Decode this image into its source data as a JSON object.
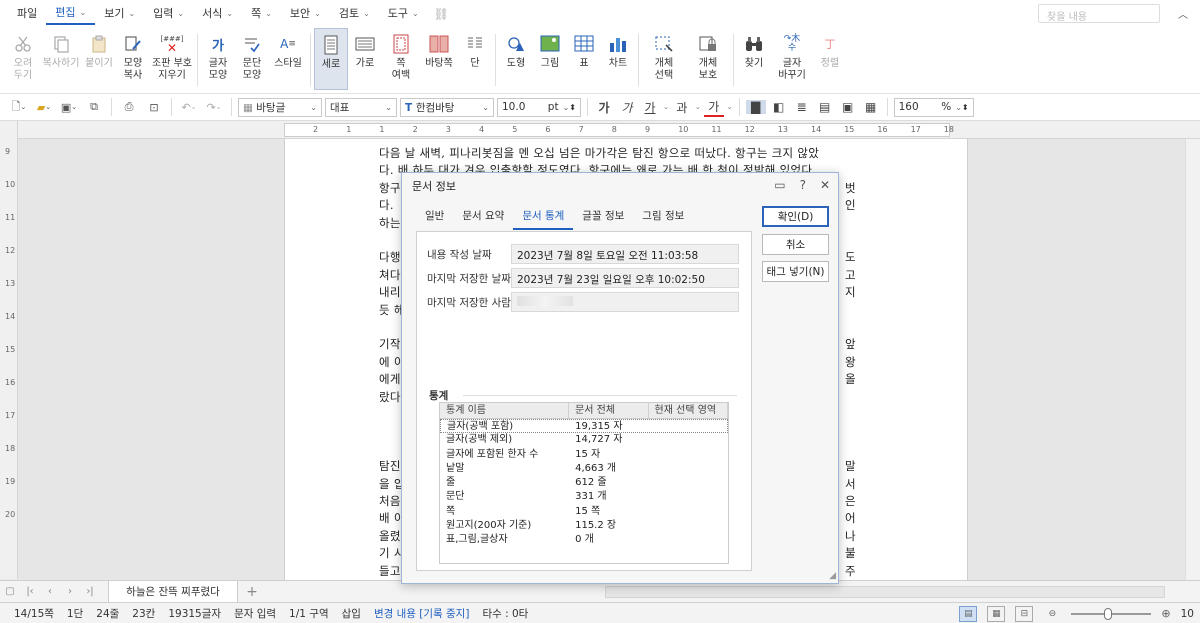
{
  "menubar": {
    "items": [
      {
        "label": "파일",
        "chev": false
      },
      {
        "label": "편집",
        "chev": true,
        "active": true
      },
      {
        "label": "보기",
        "chev": true
      },
      {
        "label": "입력",
        "chev": true
      },
      {
        "label": "서식",
        "chev": true
      },
      {
        "label": "쪽",
        "chev": true
      },
      {
        "label": "보안",
        "chev": true
      },
      {
        "label": "검토",
        "chev": true
      },
      {
        "label": "도구",
        "chev": true
      }
    ],
    "search_placeholder": "찾을 내용"
  },
  "ribbon": {
    "cut": "오려\n두기",
    "copy": "복사하기",
    "paste": "붙이기",
    "format_copy": "모양\n복사",
    "clear_markup": "조판 부호\n지우기",
    "char_shape": "글자\n모양",
    "para_shape": "문단\n모양",
    "style": "스타일",
    "vertical": "세로",
    "horizontal": "가로",
    "margin": "쪽\n여백",
    "page_bg": "바탕쪽",
    "columns": "단",
    "shapes": "도형",
    "picture": "그림",
    "table": "표",
    "chart": "차트",
    "obj_select": "개체\n선택",
    "obj_protect": "개체\n보호",
    "find": "찾기",
    "replace": "글자\n바꾸기",
    "cleanup": "정렬",
    "clear_icon_text": "[###]"
  },
  "format": {
    "style_name": "바탕글",
    "lang": "대표",
    "font": "한컴바탕",
    "size": "10.0",
    "unit": "pt",
    "zoom": "160",
    "zoom_unit": "%"
  },
  "ruler": {
    "h_numbers": [
      "2",
      "1",
      "1",
      "2",
      "3",
      "4",
      "5",
      "6",
      "7",
      "8",
      "9",
      "10",
      "11",
      "12",
      "13",
      "14",
      "15",
      "16",
      "17",
      "18"
    ],
    "v_numbers": [
      "9",
      "10",
      "11",
      "12",
      "13",
      "14",
      "15",
      "16",
      "17",
      "18",
      "19",
      "20"
    ]
  },
  "document": {
    "lines": [
      "다음 날 새벽, 피나리봇짐을 멘 오십 넘은 마가각은 탐진 항으로 떠났다. 항구는 크지 않았",
      "다. 배 하두 대가 겨우 입출항할 정도였다. 항구에는 왜로 가는 배 한 척이 정박해 있었다.",
      "항구",
      "다.",
      "하는",
      "",
      "다행",
      "쳐다",
      "내리",
      "듯 헤",
      "",
      "기작",
      "에 이",
      "에게",
      "랐다",
      "",
      "",
      "",
      "탐진",
      "을 입",
      "처음",
      "배 이",
      "올렸",
      "기 시",
      "들고"
    ],
    "right_chars": [
      "",
      "",
      "벗",
      "인",
      "",
      "",
      "도",
      "고",
      "지",
      "",
      "",
      "앞",
      "왕",
      "올",
      "",
      "",
      "",
      "",
      "말",
      "서",
      "은",
      "어",
      "나",
      "불",
      "주"
    ]
  },
  "tabs": {
    "doc_tab": "하늘은 잔뜩 찌푸렸다",
    "add": "+"
  },
  "status": {
    "page": "14/15쪽",
    "column": "1단",
    "line": "24줄",
    "col": "23칸",
    "chars": "19315글자",
    "mode": "문자 입력",
    "section": "1/1 구역",
    "insert": "삽입",
    "track": "변경 내용 [기록 중지]",
    "strokes": "타수 : 0타",
    "zoom_label": "10"
  },
  "dialog": {
    "title": "문서 정보",
    "tabs": [
      "일반",
      "문서 요약",
      "문서 통계",
      "글꼴 정보",
      "그림 정보"
    ],
    "active_tab": 2,
    "fields": [
      {
        "label": "내용 작성 날짜",
        "value": "2023년 7월 8일 토요일 오전 11:03:58"
      },
      {
        "label": "마지막 저장한 날짜",
        "value": "2023년 7월 23일 일요일 오후 10:02:50"
      },
      {
        "label": "마지막 저장한 사람",
        "value": ""
      }
    ],
    "stats_section": "통계",
    "stats_headers": [
      "통계 이름",
      "문서 전체",
      "현재 선택 영역"
    ],
    "stats_rows": [
      {
        "name": "글자(공백 포함)",
        "total": "19,315 자",
        "sel": ""
      },
      {
        "name": "글자(공백 제외)",
        "total": "14,727 자",
        "sel": ""
      },
      {
        "name": "글자에 포함된 한자 수",
        "total": "15 자",
        "sel": ""
      },
      {
        "name": "낱말",
        "total": "4,663 개",
        "sel": ""
      },
      {
        "name": "줄",
        "total": "612 줄",
        "sel": ""
      },
      {
        "name": "문단",
        "total": "331 개",
        "sel": ""
      },
      {
        "name": "쪽",
        "total": "15 쪽",
        "sel": ""
      },
      {
        "name": "원고지(200자 기준)",
        "total": "115.2 장",
        "sel": ""
      },
      {
        "name": "표,그림,글상자",
        "total": "0 개",
        "sel": ""
      }
    ],
    "buttons": {
      "ok": "확인(D)",
      "cancel": "취소",
      "tag": "태그 넣기(N)"
    }
  },
  "colors": {
    "accent": "#1f5fbf",
    "dialog_border": "#9db6d8"
  }
}
